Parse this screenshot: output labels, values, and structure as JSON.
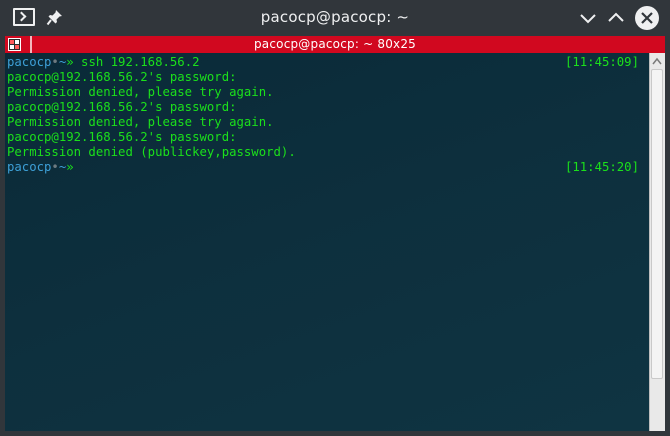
{
  "window": {
    "title": "pacocp@pacocp: ~",
    "icons": [
      "terminal-app-icon",
      "pin-icon",
      "minimize-icon",
      "maximize-icon",
      "close-icon"
    ]
  },
  "tab": {
    "title": "pacocp@pacocp: ~ 80x25",
    "color": "#d1081f"
  },
  "terminal": {
    "lines": [
      {
        "type": "prompt",
        "user": "pacocp",
        "dot": "•",
        "cwd": "~",
        "arrow": "»",
        "command": " ssh 192.168.56.2",
        "timestamp": "[11:45:09]"
      },
      {
        "type": "output",
        "text": "pacocp@192.168.56.2's password:"
      },
      {
        "type": "output",
        "text": "Permission denied, please try again."
      },
      {
        "type": "output",
        "text": "pacocp@192.168.56.2's password:"
      },
      {
        "type": "output",
        "text": "Permission denied, please try again."
      },
      {
        "type": "output",
        "text": "pacocp@192.168.56.2's password:"
      },
      {
        "type": "output",
        "text": "Permission denied (publickey,password)."
      },
      {
        "type": "prompt",
        "user": "pacocp",
        "dot": "•",
        "cwd": "~",
        "arrow": "»",
        "command": "",
        "timestamp": "[11:45:20]"
      }
    ],
    "colors": {
      "background": "#0d2f3d",
      "text": "#1be01b",
      "prompt_user": "#3d9fd6"
    }
  }
}
